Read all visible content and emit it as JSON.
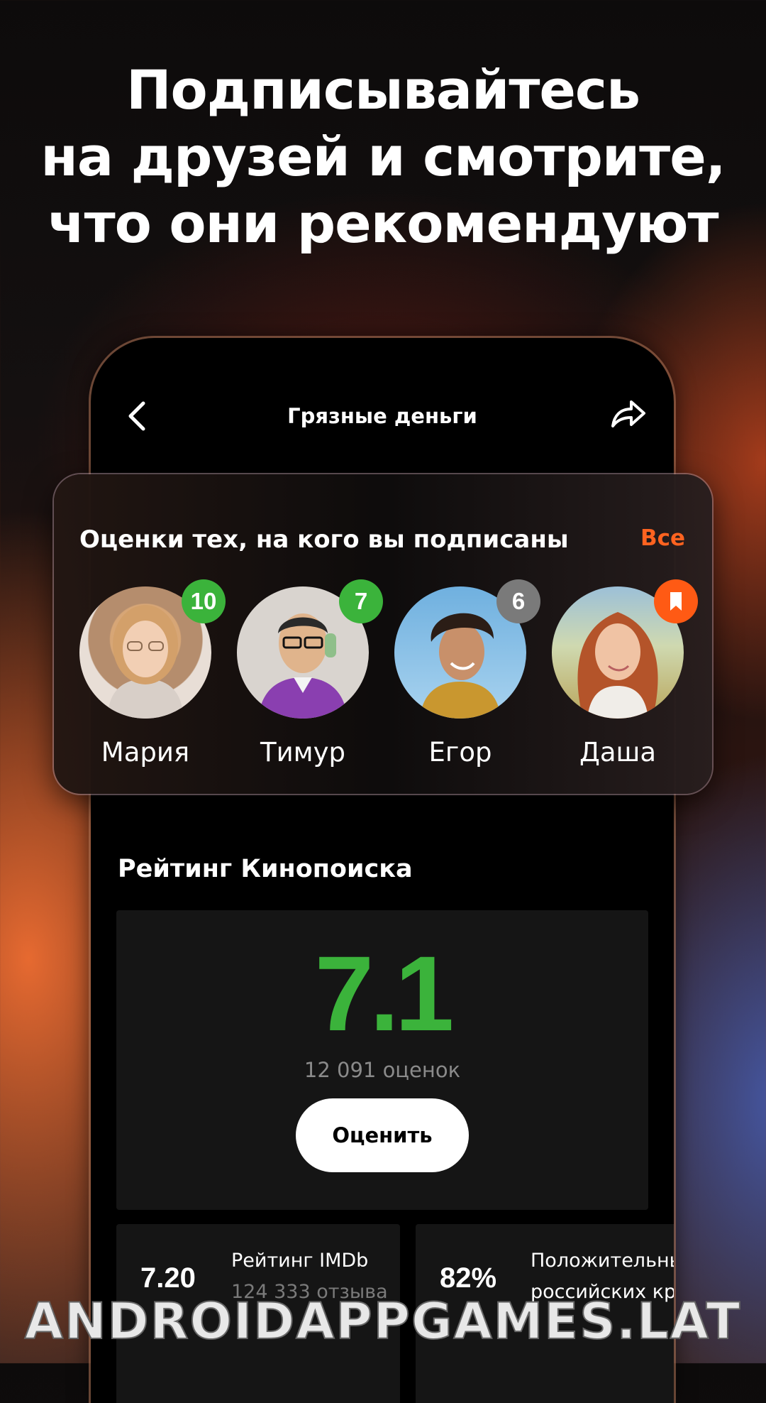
{
  "headline": [
    "Подписывайтесь",
    "на друзей и смотрите,",
    "что они рекомендуют"
  ],
  "nav": {
    "title": "Грязные деньги",
    "back_icon": "chevron-left-icon",
    "share_icon": "share-arrow-icon"
  },
  "friends": {
    "title": "Оценки тех, на кого вы подписаны",
    "all_label": "Все",
    "items": [
      {
        "name": "Мария",
        "badge": "10",
        "badge_color": "#3bb33b"
      },
      {
        "name": "Тимур",
        "badge": "7",
        "badge_color": "#3bb33b"
      },
      {
        "name": "Егор",
        "badge": "6",
        "badge_color": "#7a7a7a"
      },
      {
        "name": "Даша",
        "badge": "",
        "badge_icon": "bookmark-icon",
        "badge_color": "#ff5a14"
      }
    ]
  },
  "kinopoisk": {
    "heading": "Рейтинг Кинопоиска",
    "value": "7.1",
    "count": "12 091 оценок",
    "rate_button": "Оценить",
    "value_color": "#3bb33b"
  },
  "imdb": {
    "value": "7.20",
    "label": "Рейтинг IMDb",
    "sub": "124 333 отзыва"
  },
  "critics": {
    "value": "82%",
    "label": "Положительны",
    "sub": "российских кр"
  },
  "watermark": "ANDROIDAPPGAMES.LAT",
  "accent_color": "#ff6320"
}
